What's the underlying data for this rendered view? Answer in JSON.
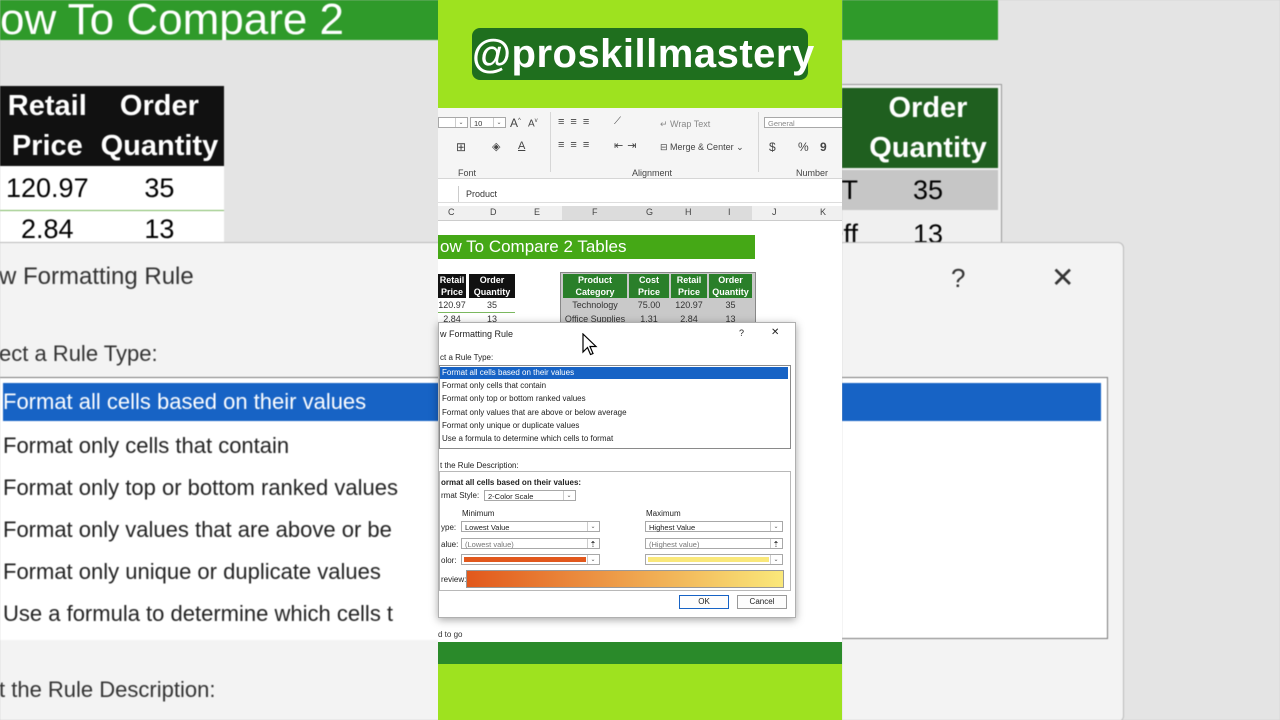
{
  "watermark": "@proskillmastery",
  "background": {
    "banner_text": "ow To Compare 2",
    "left_table": {
      "headers": [
        [
          "Retail",
          "Price"
        ],
        [
          "Order",
          "Quantity"
        ]
      ],
      "rows": [
        [
          "120.97",
          "35"
        ],
        [
          "2.84",
          "13"
        ]
      ]
    },
    "right_table": {
      "headers": [
        [
          "Order",
          "Quantity"
        ]
      ],
      "row_labels": [
        "T",
        "Off"
      ],
      "rows": [
        "35",
        "13"
      ]
    },
    "dialog": {
      "title": "w Formatting Rule",
      "help": "?",
      "close": "✕",
      "select_label": "ect a Rule Type:",
      "rule_types": [
        "Format all cells based on their values",
        "Format only cells that contain",
        "Format only top or bottom ranked values",
        "Format only values that are above or be",
        "Format only unique or duplicate values",
        "Use a formula to determine which cells t"
      ],
      "edit_label": "t the Rule Description:"
    }
  },
  "excel": {
    "ribbon": {
      "font_size": "10",
      "wrap_text": "Wrap Text",
      "merge_center": "Merge & Center",
      "number_format": "General",
      "currency": "$",
      "percent": "%",
      "comma": "9",
      "group_font": "Font",
      "group_alignment": "Alignment",
      "group_number": "Number",
      "font_grow": "A",
      "font_shrink": "A",
      "font_color": "A"
    },
    "formula_bar": {
      "value": "Product"
    },
    "columns": [
      "C",
      "D",
      "E",
      "F",
      "G",
      "H",
      "I",
      "J",
      "K"
    ],
    "sheet_title": "ow To Compare 2 Tables",
    "left_table": {
      "headers": [
        [
          "Retail",
          "Price"
        ],
        [
          "Order",
          "Quantity"
        ]
      ],
      "rows": [
        [
          "120.97",
          "35"
        ],
        [
          "2.84",
          "13"
        ]
      ]
    },
    "right_table": {
      "headers": [
        [
          "Product",
          "Category"
        ],
        [
          "Cost",
          "Price"
        ],
        [
          "Retail",
          "Price"
        ],
        [
          "Order",
          "Quantity"
        ]
      ],
      "rows": [
        [
          "Technology",
          "75.00",
          "120.97",
          "35"
        ],
        [
          "Office Supplies",
          "1.31",
          "2.84",
          "13"
        ]
      ]
    },
    "status_text": "d to go"
  },
  "dialog": {
    "title": "w Formatting Rule",
    "help": "?",
    "close": "✕",
    "select_label": "ct a Rule Type:",
    "rule_types": [
      "Format all cells based on their values",
      "Format only cells that contain",
      "Format only top or bottom ranked values",
      "Format only values that are above or below average",
      "Format only unique or duplicate values",
      "Use a formula to determine which cells to format"
    ],
    "selected_index": 0,
    "edit_label": "t the Rule Description:",
    "desc_heading": "ormat all cells based on their values:",
    "format_style_label": "rmat Style:",
    "format_style_value": "2-Color Scale",
    "minimum": {
      "heading": "Minimum",
      "type_label": "ype:",
      "type_value": "Lowest Value",
      "value_label": "alue:",
      "value_placeholder": "(Lowest value)",
      "color_label": "olor:",
      "color": "#e2581c"
    },
    "maximum": {
      "heading": "Maximum",
      "type_value": "Highest Value",
      "value_placeholder": "(Highest value)",
      "color": "#fae87a"
    },
    "preview_label": "review:",
    "ok": "OK",
    "cancel": "Cancel"
  },
  "colors": {
    "accent_green": "#9ee21f",
    "banner_green": "#45a816",
    "selection_blue": "#1763c5"
  }
}
